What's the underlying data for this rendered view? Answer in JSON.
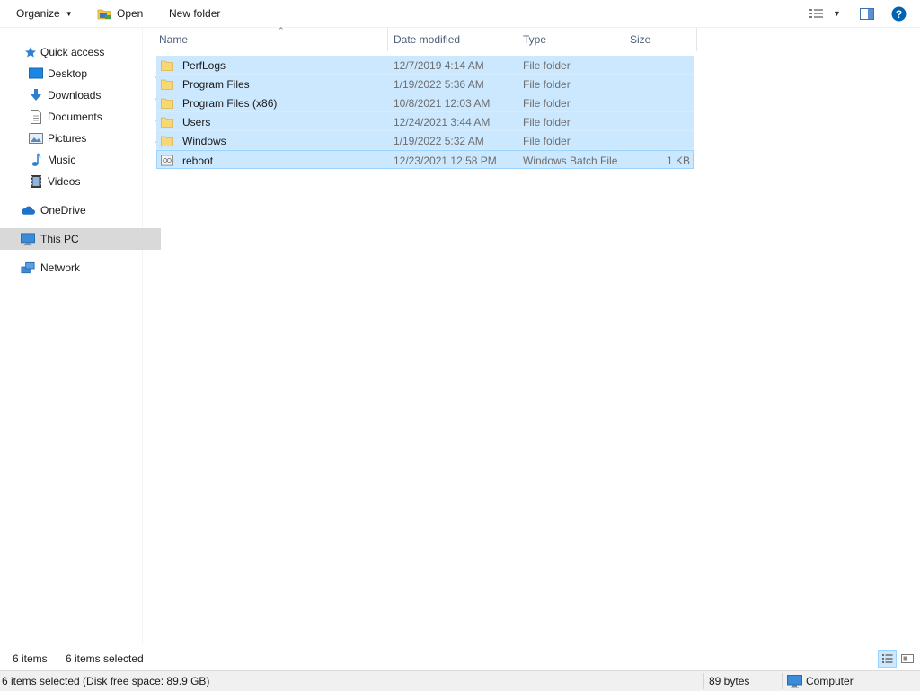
{
  "toolbar": {
    "organize_label": "Organize",
    "open_label": "Open",
    "new_folder_label": "New folder"
  },
  "nav": {
    "quick_access": "Quick access",
    "pinned": [
      {
        "label": "Desktop",
        "icon": "desktop-icon"
      },
      {
        "label": "Downloads",
        "icon": "downloads-icon"
      },
      {
        "label": "Documents",
        "icon": "documents-icon"
      },
      {
        "label": "Pictures",
        "icon": "pictures-icon"
      }
    ],
    "unpinned": [
      {
        "label": "Music",
        "icon": "music-icon"
      },
      {
        "label": "Videos",
        "icon": "videos-icon"
      }
    ],
    "onedrive": "OneDrive",
    "this_pc": "This PC",
    "network": "Network"
  },
  "columns": {
    "name": "Name",
    "date": "Date modified",
    "type": "Type",
    "size": "Size"
  },
  "files": [
    {
      "name": "PerfLogs",
      "date": "12/7/2019 4:14 AM",
      "type": "File folder",
      "size": "",
      "icon": "folder-icon"
    },
    {
      "name": "Program Files",
      "date": "1/19/2022 5:36 AM",
      "type": "File folder",
      "size": "",
      "icon": "folder-icon"
    },
    {
      "name": "Program Files (x86)",
      "date": "10/8/2021 12:03 AM",
      "type": "File folder",
      "size": "",
      "icon": "folder-icon"
    },
    {
      "name": "Users",
      "date": "12/24/2021 3:44 AM",
      "type": "File folder",
      "size": "",
      "icon": "folder-icon"
    },
    {
      "name": "Windows",
      "date": "1/19/2022 5:32 AM",
      "type": "File folder",
      "size": "",
      "icon": "folder-icon"
    },
    {
      "name": "reboot",
      "date": "12/23/2021 12:58 PM",
      "type": "Windows Batch File",
      "size": "1 KB",
      "icon": "batch-file-icon"
    }
  ],
  "info": {
    "count": "6 items",
    "selected": "6 items selected"
  },
  "status": {
    "main": "6 items selected (Disk free space: 89.9 GB)",
    "size": "89 bytes",
    "location": "Computer"
  },
  "colors": {
    "selection": "#cce8ff",
    "selection_border": "#99d1ff",
    "nav_selected": "#d9d9d9",
    "header_text": "#4c607a",
    "help_blue": "#0063b1"
  }
}
